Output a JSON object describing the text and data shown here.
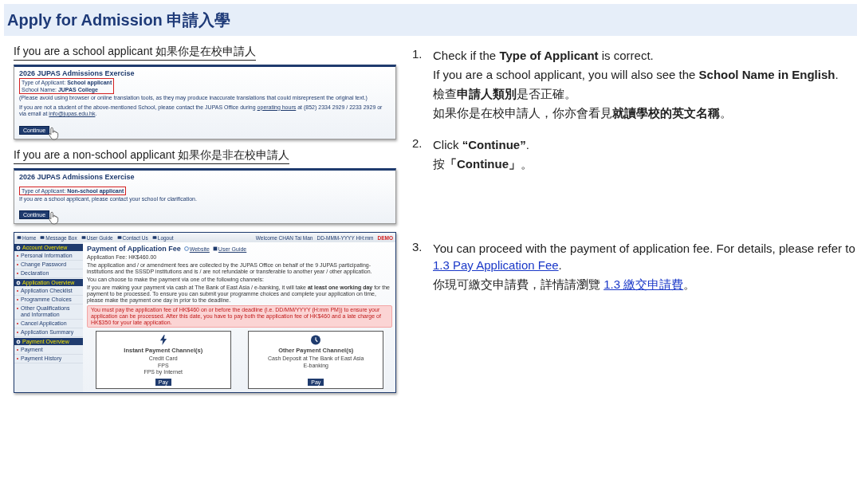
{
  "title": "Apply for Admission 申請入學",
  "cases": [
    {
      "heading": "If you are a school applicant 如果你是在校申請人",
      "screenshot": {
        "title": "2026 JUPAS Admissions Exercise",
        "highlighted": [
          "Type of Applicant: **School applicant**",
          "School Name: **JUPAS College**"
        ],
        "notes": [
          [
            {
              "kind": "text",
              "text": "(Please avoid using browser or online translation tools, as they may produce inaccurate translations that could misrepresent the original text.)"
            }
          ],
          [
            {
              "kind": "text",
              "text": "If you are not a student of the above-mentioned School, please contact the JUPAS Office during "
            },
            {
              "kind": "link",
              "text": "operating hours"
            },
            {
              "kind": "text",
              "text": " at (852) 2334 2929 / 2233 2929 or via email at "
            },
            {
              "kind": "link",
              "text": "info@jupas.edu.hk"
            },
            {
              "kind": "text",
              "text": "."
            }
          ]
        ],
        "button": "Continue"
      }
    },
    {
      "heading": "If you are a non-school applicant 如果你是非在校申請人",
      "screenshot": {
        "title": "2026 JUPAS Admissions Exercise",
        "highlighted": [
          "Type of Applicant: **Non-school applicant**"
        ],
        "notes": [
          [
            {
              "kind": "text",
              "text": "If you are a school applicant, please contact your school for clarification."
            }
          ]
        ],
        "button": "Continue"
      }
    }
  ],
  "steps_top": [
    {
      "number": "1.",
      "lines": [
        [
          {
            "kind": "text",
            "text": "Check if the **Type of Applicant** is correct."
          }
        ],
        [
          {
            "kind": "text",
            "text": "If you are a school applicant, you will also see the **School Name in English**."
          }
        ],
        [
          {
            "kind": "text",
            "text": "檢查**申請人類別**是否正確。"
          }
        ],
        [
          {
            "kind": "text",
            "text": "如果你是在校申請人，你亦會看見**就讀學校的英文名稱**。"
          }
        ]
      ]
    },
    {
      "number": "2.",
      "lines": [
        [
          {
            "kind": "text",
            "text": "Click **“Continue”**."
          }
        ],
        [
          {
            "kind": "text",
            "text": "按**「Continue」**。"
          }
        ]
      ]
    }
  ],
  "payment": {
    "nav": [
      "Home",
      "Message Box",
      "User Guide",
      "Contact Us",
      "Logout"
    ],
    "user": "Welcome CHAN Tai Man",
    "datetime": "DD-MMM-YYYY HH:mm",
    "badge": "DEMO",
    "sidebar": [
      {
        "label": "Account Overview",
        "children": [
          {
            "label": "Personal Information"
          },
          {
            "label": "Change Password"
          },
          {
            "label": "Declaration"
          }
        ]
      },
      {
        "label": "Application Overview",
        "children": [
          {
            "label": "Application Checklist"
          },
          {
            "label": "Programme Choices"
          },
          {
            "label": "Other Qualifications and Information"
          },
          {
            "label": "Cancel Application"
          },
          {
            "label": "Application Summary"
          }
        ]
      },
      {
        "label": "Payment Overview",
        "children": [
          {
            "label": "Payment"
          },
          {
            "label": "Payment History"
          }
        ]
      }
    ],
    "title": "Payment of Application Fee",
    "title_links": [
      "Website",
      "User Guide"
    ],
    "fee": "Application Fee: HK$460.00",
    "paragraphs": [
      "The application and / or amendment fees are collected by the JUPAS Office on behalf of the 9 JUPAS participating-institutions and the SSSDP institutions and is / are not refundable or transferable to another year / other application.",
      "You can choose to make the payment via one of the following channels:",
      "If you are making your payment via cash at The Bank of East Asia / e-banking, it will take **at least one working day** for the payment to be processed. To ensure you can submit your programme choices and complete your application on time, please make the payment one day in prior to the deadline."
    ],
    "alert": "You must pay the application fee of HK$460 on or before the deadline (i.e. DD/MM/YYYY (H:mm PM)) to ensure your application can be processed. After this date, you have to pay both the application fee of HK$460 and a late charge of HK$350 for your late application.",
    "channels": [
      {
        "kind": "instant",
        "title": "Instant Payment Channel(s)",
        "items": [
          "Credit Card",
          "FPS",
          "FPS by Internet"
        ],
        "button": "Pay"
      },
      {
        "kind": "other",
        "title": "Other Payment Channel(s)",
        "items": [
          "Cash Deposit at The Bank of East Asia",
          "E-banking"
        ],
        "button": "Pay"
      }
    ]
  },
  "steps_bottom": [
    {
      "number": "3.",
      "lines": [
        [
          {
            "kind": "text",
            "text": "You can proceed with the payment of application fee.  For details, please refer to "
          },
          {
            "kind": "link",
            "text": "1.3 Pay Application Fee"
          },
          {
            "kind": "text",
            "text": "."
          }
        ],
        [
          {
            "kind": "text",
            "text": "你現可繳交申請費，詳情請瀏覽 "
          },
          {
            "kind": "link",
            "text": "1.3 繳交申請費"
          },
          {
            "kind": "text",
            "text": "。"
          }
        ]
      ]
    }
  ]
}
